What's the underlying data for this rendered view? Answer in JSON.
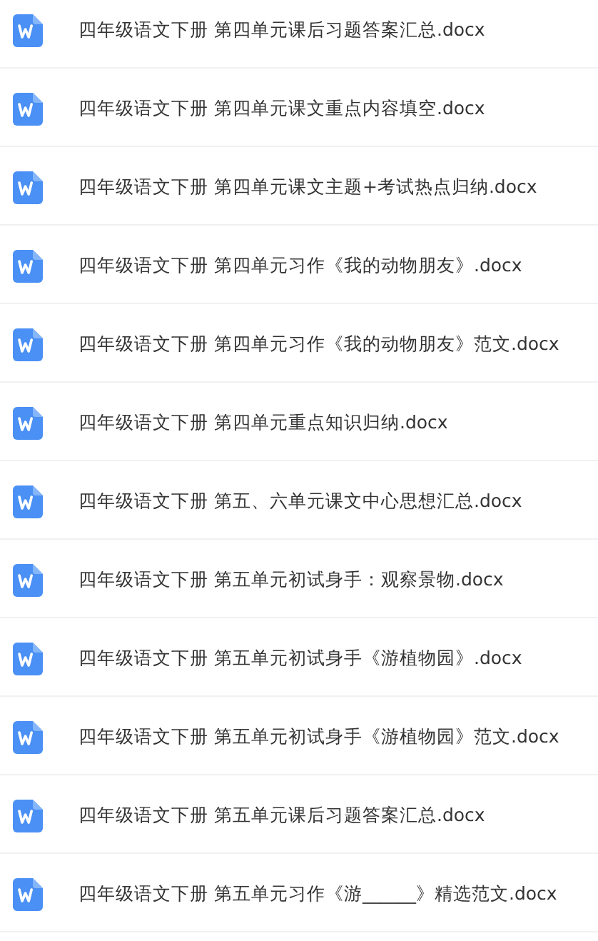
{
  "files": [
    {
      "name": "四年级语文下册 第四单元课后习题答案汇总.docx"
    },
    {
      "name": "四年级语文下册 第四单元课文重点内容填空.docx"
    },
    {
      "name": "四年级语文下册 第四单元课文主题+考试热点归纳.docx"
    },
    {
      "name": "四年级语文下册 第四单元习作《我的动物朋友》.docx"
    },
    {
      "name": "四年级语文下册 第四单元习作《我的动物朋友》范文.docx"
    },
    {
      "name": "四年级语文下册 第四单元重点知识归纳.docx"
    },
    {
      "name": "四年级语文下册 第五、六单元课文中心思想汇总.docx"
    },
    {
      "name": "四年级语文下册 第五单元初试身手：观察景物.docx"
    },
    {
      "name": "四年级语文下册 第五单元初试身手《游植物园》.docx"
    },
    {
      "name": "四年级语文下册 第五单元初试身手《游植物园》范文.docx"
    },
    {
      "name": "四年级语文下册 第五单元课后习题答案汇总.docx"
    },
    {
      "name": "四年级语文下册 第五单元习作《游______》精选范文.docx"
    }
  ]
}
